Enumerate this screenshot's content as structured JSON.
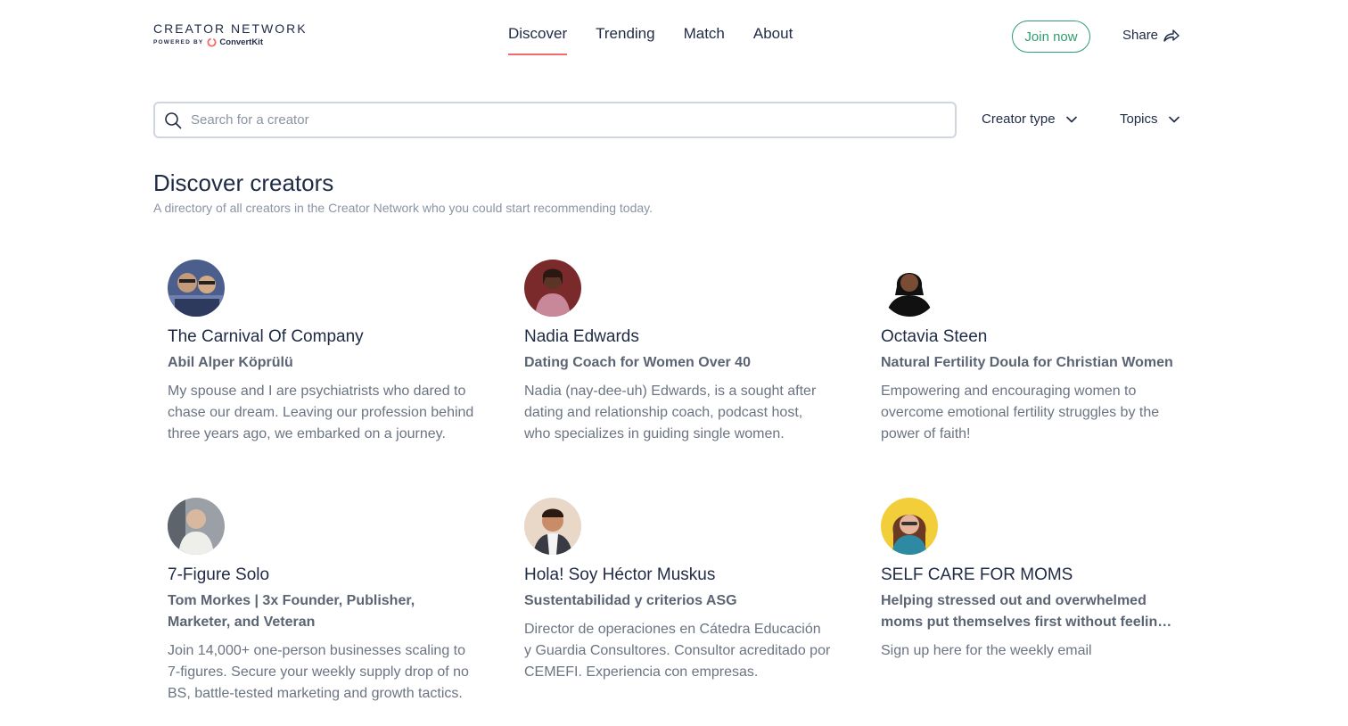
{
  "brand": {
    "title": "CREATOR NETWORK",
    "powered_by": "POWERED BY",
    "partner": "ConvertKit",
    "accent": "#f26b6b"
  },
  "nav": {
    "items": [
      {
        "label": "Discover",
        "active": true
      },
      {
        "label": "Trending",
        "active": false
      },
      {
        "label": "Match",
        "active": false
      },
      {
        "label": "About",
        "active": false
      }
    ]
  },
  "header": {
    "join_label": "Join now",
    "share_label": "Share",
    "join_color": "#2f9e6e"
  },
  "search": {
    "placeholder": "Search for a creator",
    "value": ""
  },
  "filters": {
    "creator_type": "Creator type",
    "topics": "Topics"
  },
  "main": {
    "title": "Discover creators",
    "subtitle": "A directory of all creators in the Creator Network who you could start recommending today."
  },
  "creators": [
    {
      "name": "The Carnival Of Company",
      "tagline": "Abil Alper Köprülü",
      "description": "My spouse and I are psychiatrists who dared to chase our dream. Leaving our profession behind three years ago, we embarked on a journey.",
      "avatar_color": "#4b5e8c"
    },
    {
      "name": "Nadia Edwards",
      "tagline": "Dating Coach for Women Over 40",
      "description": "Nadia (nay-dee-uh) Edwards, is a sought after dating and relationship coach, podcast host, who specializes in guiding single women.",
      "avatar_color": "#7a2a2a"
    },
    {
      "name": "Octavia Steen",
      "tagline": "Natural Fertility Doula for Christian Women",
      "description": "Empowering and encouraging women to overcome emotional fertility struggles by the power of faith!",
      "avatar_color": "#111111"
    },
    {
      "name": "7-Figure Solo",
      "tagline": "Tom Morkes | 3x Founder, Publisher, Marketer, and Veteran",
      "description": "Join 14,000+ one-person businesses scaling to 7-figures. Secure your weekly supply drop of no BS, battle-tested marketing and growth tactics.",
      "avatar_color": "#c8c2b8"
    },
    {
      "name": "Hola! Soy Héctor Muskus",
      "tagline": "Sustentabilidad y criterios ASG",
      "description": "Director de operaciones en Cátedra Educación y Guardia Consultores. Consultor acreditado por CEMEFI. Experiencia con empresas.",
      "avatar_color": "#e9d7c7"
    },
    {
      "name": "SELF CARE FOR MOMS",
      "tagline": "Helping stressed out and overwhelmed moms put themselves first without feeling guilty",
      "description": "Sign up here for the weekly email",
      "avatar_color": "#f2cf3a"
    }
  ]
}
